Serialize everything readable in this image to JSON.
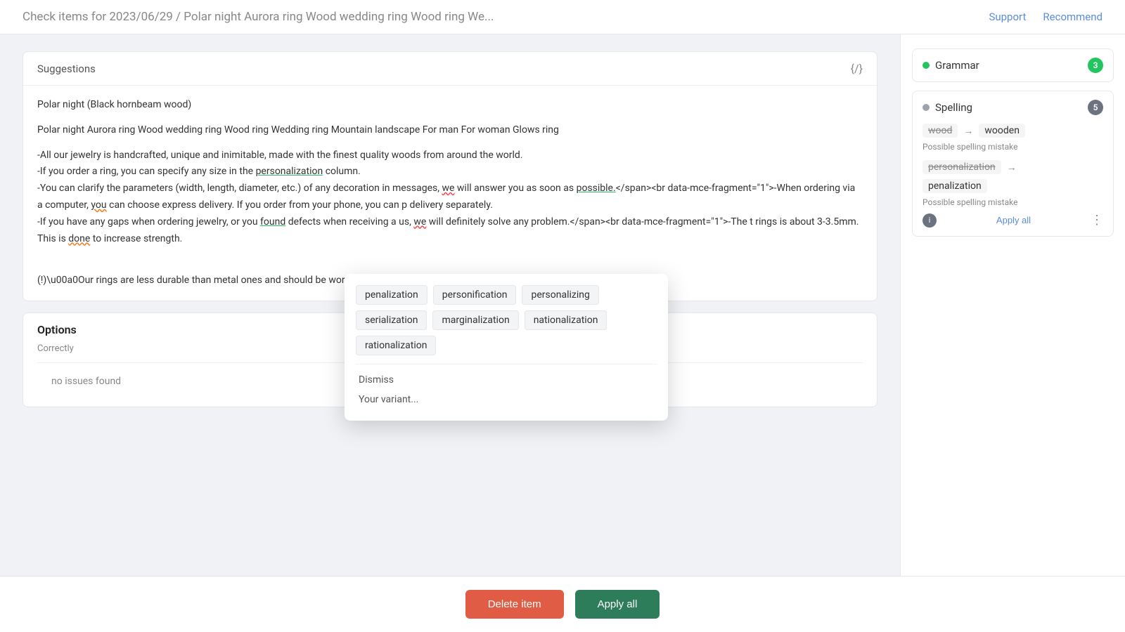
{
  "header": {
    "title_prefix": "Check items for 2023/06/29",
    "separator": "/",
    "title_suffix": "Polar night Aurora ring Wood wedding ring Wood ring We...",
    "support_label": "Support",
    "recommend_label": "Recommend"
  },
  "suggestions_card": {
    "header_label": "Suggestions",
    "header_icon": "{/}",
    "paragraph1": "Polar night (Black hornbeam wood)",
    "paragraph2": "Polar night Aurora ring Wood wedding ring Wood ring Wedding ring Mountain landscape For man For woman Glows ring",
    "paragraph3_lines": [
      "-All our jewelry is handcrafted, unique and inimitable, made with the finest quality woods from around the world.",
      "-If you order a ring, you can specify any size in the personalization column.",
      "-You can clarify the parameters (width, length, diameter, etc.) of any decoration in messages, we will answer you as soon as possible.</span><br data-mce-fragment=\"1\">-When ordering via a computer, you can choose express delivery. If you order from your phone, you can p delivery separately.",
      "-If you have any gaps when ordering jewelry, or you found defects when receiving a us, we will definitely solve any problem.</span><br data-mce-fragment=\"1\">-The t rings is about 3-3.5mm. This is done to increase strength.",
      "(!) Our rings are less durable than metal ones and should be worn carefully!"
    ]
  },
  "options_card": {
    "title": "Options",
    "field1_label": "Correctly",
    "field2_label": "no issues found"
  },
  "sidebar": {
    "grammar_label": "Grammar",
    "grammar_count": "3",
    "spelling_label": "Spelling",
    "spelling_count": "5",
    "spelling_item1": {
      "word_wrong": "wood",
      "word_correct": "wooden",
      "note": "Possible spelling mistake"
    },
    "spelling_item2": {
      "word_wrong": "personalization",
      "word_correct": "penalization",
      "note": "Possible spelling mistake"
    },
    "apply_all_label": "Apply all"
  },
  "dropdown": {
    "suggestions": [
      "penalization",
      "personification",
      "personalizing",
      "serialization",
      "marginalization",
      "nationalization",
      "rationalization"
    ],
    "dismiss_label": "Dismiss",
    "your_variant_label": "Your variant..."
  },
  "bottom_bar": {
    "delete_label": "Delete item",
    "apply_label": "Apply all"
  }
}
